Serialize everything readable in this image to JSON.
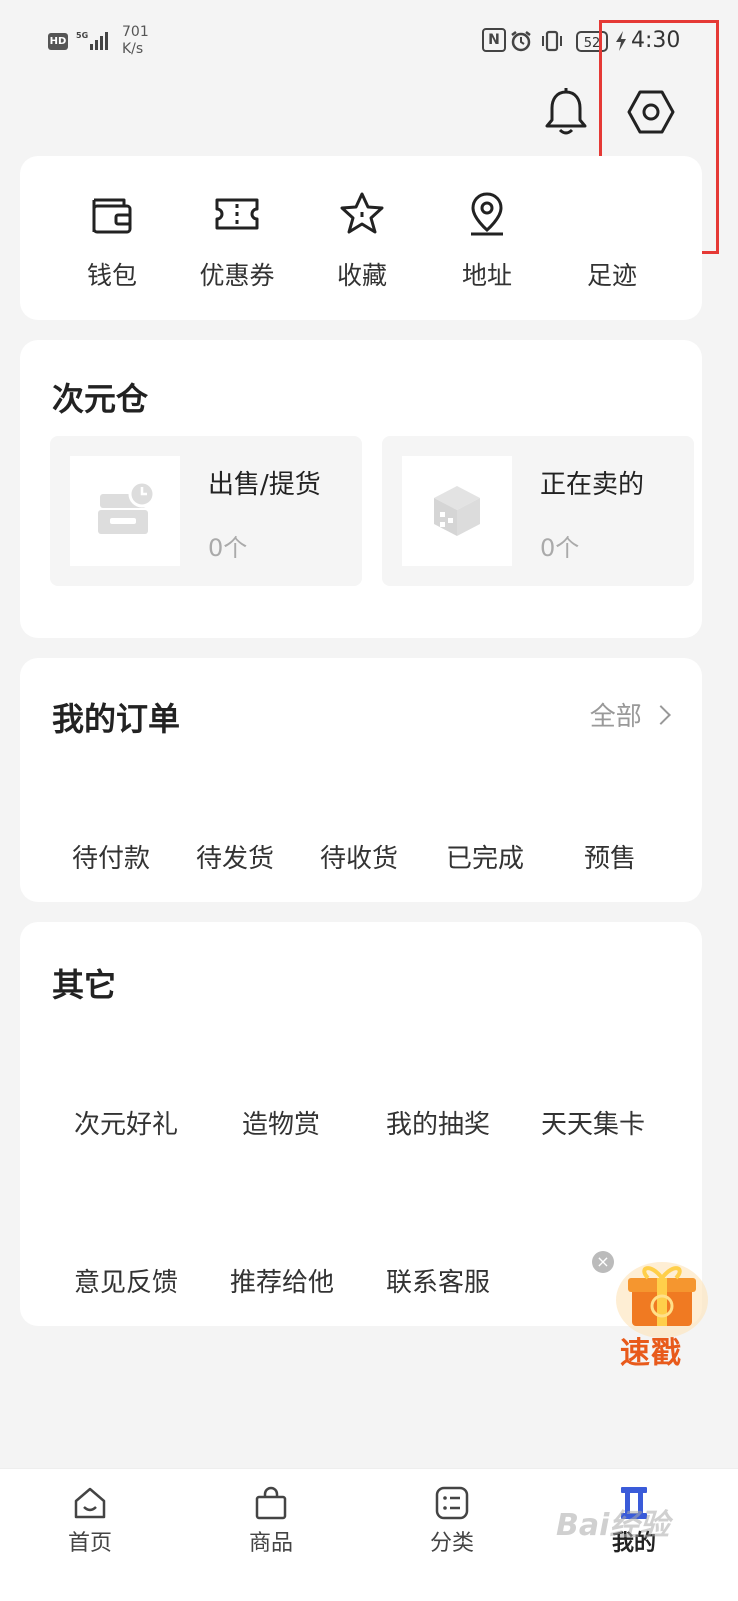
{
  "status_bar": {
    "hd": "HD",
    "network": "5G",
    "speed_value": "701",
    "speed_unit": "K/s",
    "nfc": "N",
    "battery": "52",
    "time": "4:30"
  },
  "header": {
    "icons": [
      "bell-icon",
      "settings-hexagon-icon"
    ]
  },
  "quick_links": [
    {
      "label": "钱包",
      "icon": "wallet-icon"
    },
    {
      "label": "优惠券",
      "icon": "coupon-icon"
    },
    {
      "label": "收藏",
      "icon": "star-icon"
    },
    {
      "label": "地址",
      "icon": "location-icon"
    },
    {
      "label": "足迹",
      "icon": "footprint-icon"
    }
  ],
  "warehouse": {
    "title": "次元仓",
    "tiles": [
      {
        "title": "出售/提货",
        "count": "0个",
        "icon": "inbox-clock-icon"
      },
      {
        "title": "正在卖的",
        "count": "0个",
        "icon": "box-icon"
      }
    ]
  },
  "orders": {
    "title": "我的订单",
    "all_label": "全部",
    "statuses": [
      "待付款",
      "待发货",
      "待收货",
      "已完成",
      "预售"
    ]
  },
  "other": {
    "title": "其它",
    "row1": [
      "次元好礼",
      "造物赏",
      "我的抽奖",
      "天天集卡"
    ],
    "row2": [
      "意见反馈",
      "推荐给他",
      "联系客服"
    ]
  },
  "promo": {
    "label": "速戳",
    "close": "×"
  },
  "bottom_nav": [
    {
      "label": "首页",
      "icon": "home-icon",
      "active": false
    },
    {
      "label": "商品",
      "icon": "shopping-bag-icon",
      "active": false
    },
    {
      "label": "分类",
      "icon": "list-icon",
      "active": false
    },
    {
      "label": "我的",
      "icon": "profile-icon",
      "active": true
    }
  ],
  "watermark": "Bai经验",
  "colors": {
    "background": "#f4f4f4",
    "card": "#ffffff",
    "highlight": "#e53935",
    "promo": "#e85a1b"
  }
}
